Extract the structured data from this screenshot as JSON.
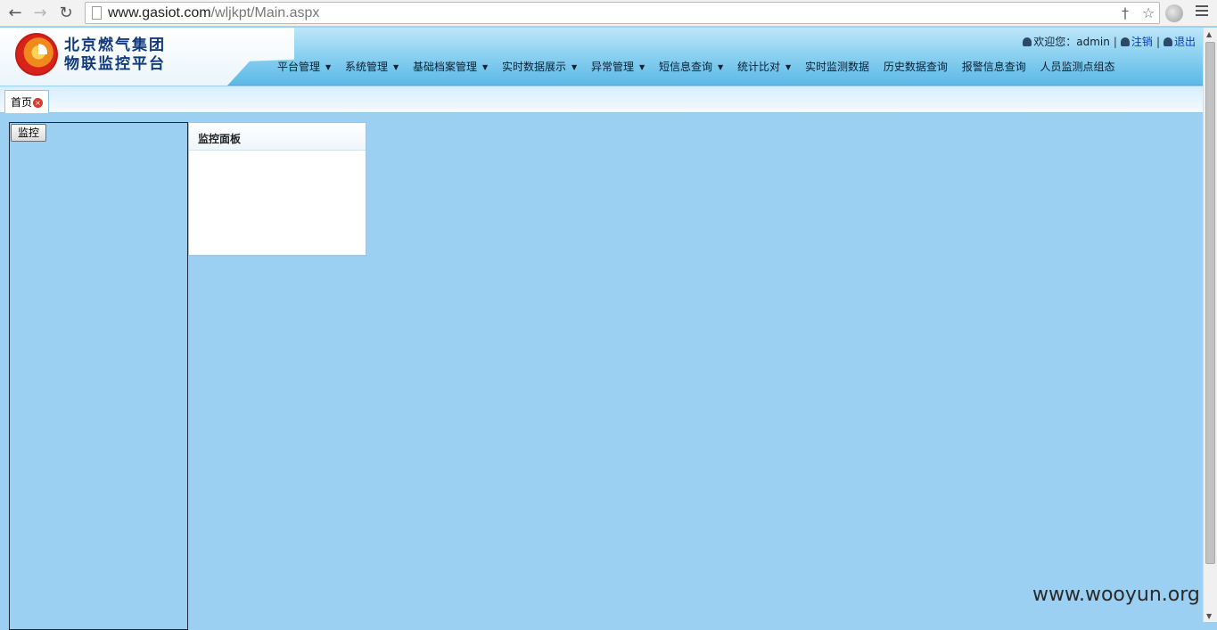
{
  "browser": {
    "url_host": "www.gasiot.com",
    "url_path": "/wljkpt/Main.aspx"
  },
  "header": {
    "logo_line1": "北京燃气集团",
    "logo_line2": "物联监控平台",
    "welcome": "欢迎您：admin",
    "logout_label": "注销",
    "exit_label": "退出",
    "separator": "|"
  },
  "menu": [
    {
      "label": "平台管理",
      "has_dropdown": true
    },
    {
      "label": "系统管理",
      "has_dropdown": true
    },
    {
      "label": "基础档案管理",
      "has_dropdown": true
    },
    {
      "label": "实时数据展示",
      "has_dropdown": true
    },
    {
      "label": "异常管理",
      "has_dropdown": true
    },
    {
      "label": "短信息查询",
      "has_dropdown": true
    },
    {
      "label": "统计比对",
      "has_dropdown": true
    },
    {
      "label": "实时监测数据",
      "has_dropdown": false
    },
    {
      "label": "历史数据查询",
      "has_dropdown": false
    },
    {
      "label": "报警信息查询",
      "has_dropdown": false
    },
    {
      "label": "人员监测点组态",
      "has_dropdown": false
    }
  ],
  "tabs": [
    {
      "label": "首页",
      "closable": true
    }
  ],
  "left_panel": {
    "button_label": "监控"
  },
  "dashboard": {
    "title": "监控面板"
  },
  "watermark": "www.wooyun.org",
  "colors": {
    "page_bg": "#9bd0f2",
    "header_gradient_top": "#bfe6f9",
    "header_gradient_bottom": "#5cb9e6",
    "link": "#0b39c8"
  }
}
